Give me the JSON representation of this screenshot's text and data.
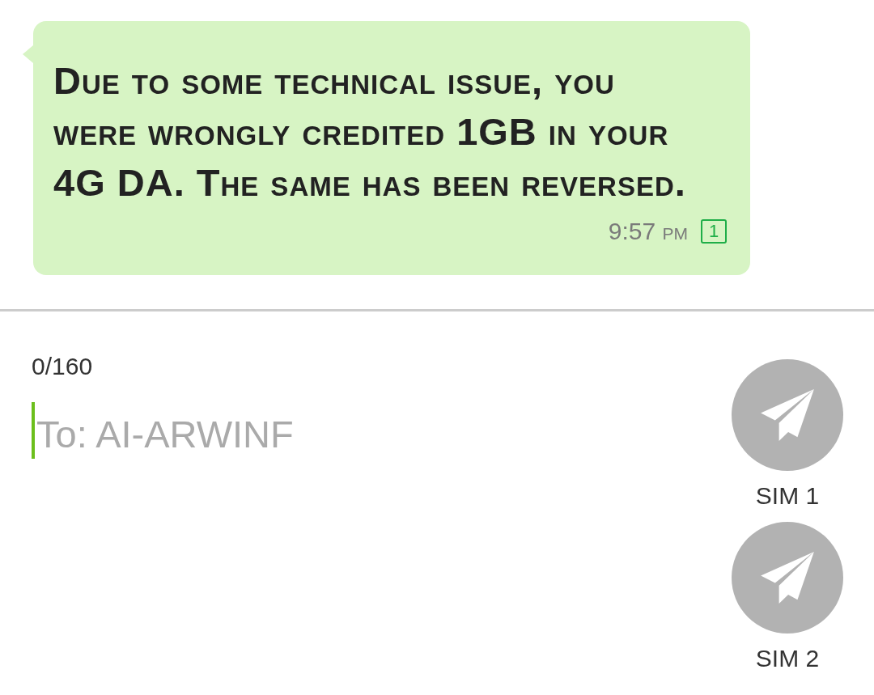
{
  "message": {
    "text": "Due to some technical issue, you were wrongly credited 1GB in your 4G DA. The same has been reversed.",
    "time": "9:57 pm",
    "sim": "1"
  },
  "composer": {
    "counter": "0/160",
    "placeholder": "To: AI-ARWINF",
    "focused": true
  },
  "send_buttons": [
    {
      "label": "SIM 1"
    },
    {
      "label": "SIM 2"
    }
  ]
}
